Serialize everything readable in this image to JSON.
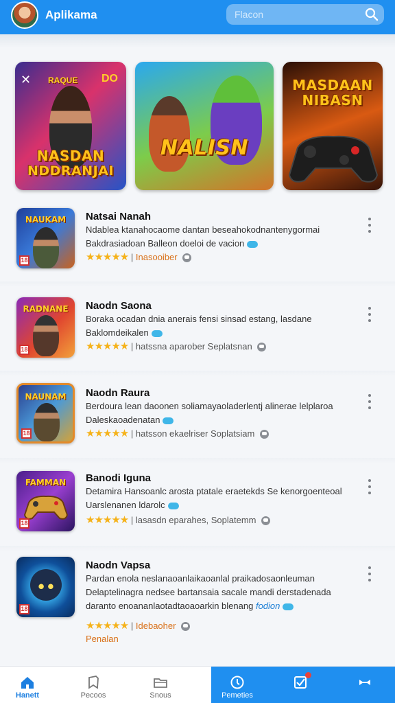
{
  "header": {
    "title": "Aplikama",
    "search_placeholder": "Flacon"
  },
  "banners": [
    {
      "title_line1": "NASDAN",
      "title_line2": "NDDRANJAI",
      "top_badge": "RAQUE",
      "top_right": "DO"
    },
    {
      "title": "NALISN"
    },
    {
      "title_line1": "MASDAAN",
      "title_line2": "NIBASN"
    }
  ],
  "list": [
    {
      "thumb_label": "NAUKAM",
      "title": "Natsai Nanah",
      "desc": "Ndablea ktanahocaome dantan beseahokodnantenygormai Bakdrasiadoan Balleon doeloi de vacion",
      "stars": "★★★★★",
      "sep": "|",
      "developer": "Inasooiber",
      "age": "18"
    },
    {
      "thumb_label": "RADNANE",
      "title": "Naodn Saona",
      "desc": "Boraka ocadan dnia anerais fensi sinsad estang, lasdane Baklomdeikalen",
      "stars": "★★★★★",
      "sep": "|",
      "developer": "hatssna aparober Seplatsnan",
      "age": "18"
    },
    {
      "thumb_label": "NAUNAM",
      "title": "Naodn Raura",
      "desc": "Berdoura lean daoonen soliamayaoladerlentj alinerae lelplaroa Daleskaoadenatan",
      "stars": "★★★★★",
      "sep": "|",
      "developer": "hatsson ekaelriser Soplatsiam",
      "age": "18"
    },
    {
      "thumb_label": "FAMMAN",
      "title": "Banodi Iguna",
      "desc": "Detamira Hansoanlc arosta ptatale eraetekds Se kenorgoenteoal Uarslenanen ldarolc",
      "stars": "★★★★★",
      "sep": "|",
      "developer": "lasasdn eparahes, Soplatemm",
      "age": "18"
    },
    {
      "thumb_label": "",
      "title": "Naodn Vapsa",
      "desc": "Pardan enola neslanaoanlaikaoanlal praikadosaonleuman Delaptelinagra nedsee bartansaia sacale mandi derstadenada daranto enoananlaotadtaoaoarkin blenang",
      "desc_link": "fodion",
      "stars": "★★★★★",
      "sep": "|",
      "developer": "Idebaoher",
      "extra": "Penalan",
      "age": "18"
    }
  ],
  "bottom_nav": [
    {
      "label": "Hanett",
      "icon": "home-icon"
    },
    {
      "label": "Pecoos",
      "icon": "bookmark-icon"
    },
    {
      "label": "Snous",
      "icon": "folder-icon"
    },
    {
      "label": "Pemeties",
      "icon": "clock-icon"
    },
    {
      "label": "",
      "icon": "checklist-icon"
    },
    {
      "label": "",
      "icon": "gamepad-icon"
    }
  ],
  "colors": {
    "primary": "#1f8ff0",
    "star": "#f5b21a",
    "developer_orange": "#d9711a",
    "background": "#f4f6f9"
  }
}
